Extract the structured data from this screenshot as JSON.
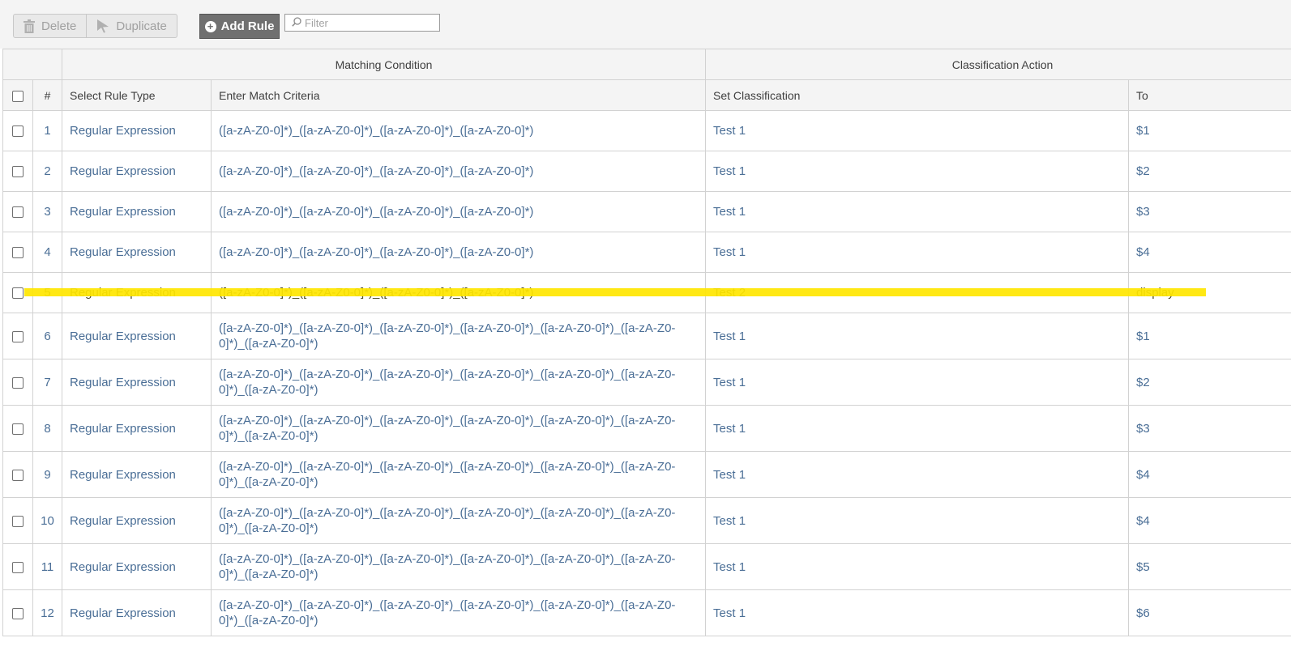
{
  "toolbar": {
    "delete_label": "Delete",
    "duplicate_label": "Duplicate",
    "add_rule_label": "Add Rule",
    "filter_placeholder": "Filter"
  },
  "table": {
    "group_headers": {
      "matching": "Matching Condition",
      "classification": "Classification Action"
    },
    "columns": {
      "num": "#",
      "rule_type": "Select Rule Type",
      "criteria": "Enter Match Criteria",
      "set_classification": "Set Classification",
      "to": "To"
    },
    "rows": [
      {
        "num": "1",
        "type": "Regular Expression",
        "criteria": "([a-zA-Z0-0]*)_([a-zA-Z0-0]*)_([a-zA-Z0-0]*)_([a-zA-Z0-0]*)",
        "classification": "Test 1",
        "to": "$1"
      },
      {
        "num": "2",
        "type": "Regular Expression",
        "criteria": "([a-zA-Z0-0]*)_([a-zA-Z0-0]*)_([a-zA-Z0-0]*)_([a-zA-Z0-0]*)",
        "classification": "Test 1",
        "to": "$2"
      },
      {
        "num": "3",
        "type": "Regular Expression",
        "criteria": "([a-zA-Z0-0]*)_([a-zA-Z0-0]*)_([a-zA-Z0-0]*)_([a-zA-Z0-0]*)",
        "classification": "Test 1",
        "to": "$3"
      },
      {
        "num": "4",
        "type": "Regular Expression",
        "criteria": "([a-zA-Z0-0]*)_([a-zA-Z0-0]*)_([a-zA-Z0-0]*)_([a-zA-Z0-0]*)",
        "classification": "Test 1",
        "to": "$4"
      },
      {
        "num": "5",
        "type": "Regular Expression",
        "criteria": "([a-zA-Z0-0]*)_([a-zA-Z0-0]*)_([a-zA-Z0-0]*)_([a-zA-Z0-0]*)",
        "classification": "Test 2",
        "to": "display"
      },
      {
        "num": "6",
        "type": "Regular Expression",
        "criteria": "([a-zA-Z0-0]*)_([a-zA-Z0-0]*)_([a-zA-Z0-0]*)_([a-zA-Z0-0]*)_([a-zA-Z0-0]*)_([a-zA-Z0-0]*)_([a-zA-Z0-0]*)",
        "classification": "Test 1",
        "to": "$1"
      },
      {
        "num": "7",
        "type": "Regular Expression",
        "criteria": "([a-zA-Z0-0]*)_([a-zA-Z0-0]*)_([a-zA-Z0-0]*)_([a-zA-Z0-0]*)_([a-zA-Z0-0]*)_([a-zA-Z0-0]*)_([a-zA-Z0-0]*)",
        "classification": "Test 1",
        "to": "$2"
      },
      {
        "num": "8",
        "type": "Regular Expression",
        "criteria": "([a-zA-Z0-0]*)_([a-zA-Z0-0]*)_([a-zA-Z0-0]*)_([a-zA-Z0-0]*)_([a-zA-Z0-0]*)_([a-zA-Z0-0]*)_([a-zA-Z0-0]*)",
        "classification": "Test 1",
        "to": "$3"
      },
      {
        "num": "9",
        "type": "Regular Expression",
        "criteria": "([a-zA-Z0-0]*)_([a-zA-Z0-0]*)_([a-zA-Z0-0]*)_([a-zA-Z0-0]*)_([a-zA-Z0-0]*)_([a-zA-Z0-0]*)_([a-zA-Z0-0]*)",
        "classification": "Test 1",
        "to": "$4"
      },
      {
        "num": "10",
        "type": "Regular Expression",
        "criteria": "([a-zA-Z0-0]*)_([a-zA-Z0-0]*)_([a-zA-Z0-0]*)_([a-zA-Z0-0]*)_([a-zA-Z0-0]*)_([a-zA-Z0-0]*)_([a-zA-Z0-0]*)",
        "classification": "Test 1",
        "to": "$4"
      },
      {
        "num": "11",
        "type": "Regular Expression",
        "criteria": "([a-zA-Z0-0]*)_([a-zA-Z0-0]*)_([a-zA-Z0-0]*)_([a-zA-Z0-0]*)_([a-zA-Z0-0]*)_([a-zA-Z0-0]*)_([a-zA-Z0-0]*)",
        "classification": "Test 1",
        "to": "$5"
      },
      {
        "num": "12",
        "type": "Regular Expression",
        "criteria": "([a-zA-Z0-0]*)_([a-zA-Z0-0]*)_([a-zA-Z0-0]*)_([a-zA-Z0-0]*)_([a-zA-Z0-0]*)_([a-zA-Z0-0]*)_([a-zA-Z0-0]*)",
        "classification": "Test 1",
        "to": "$6"
      }
    ]
  },
  "colors": {
    "link_text": "#4a6e96",
    "highlight": "#ffe600",
    "add_button": "#707070"
  },
  "icons": {
    "delete": "trash-icon",
    "duplicate": "cursor-arrow-icon",
    "add": "plus-circle-icon",
    "filter": "search-icon"
  }
}
